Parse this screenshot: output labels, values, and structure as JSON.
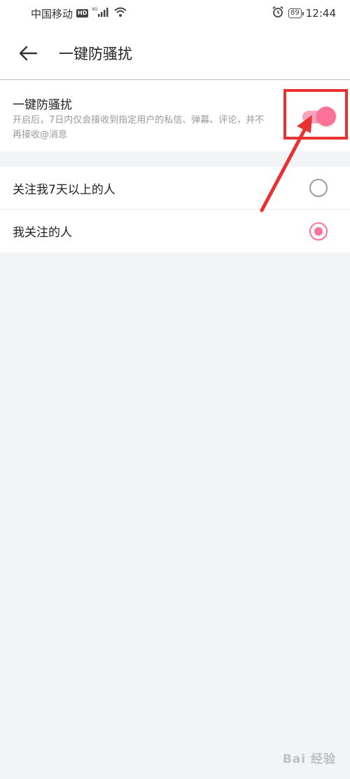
{
  "status_bar": {
    "carrier": "中国移动",
    "hd_badge": "HD",
    "network": "4G",
    "battery": "89",
    "time": "12:44",
    "icons": [
      "signal-icon",
      "wifi-icon",
      "alarm-icon",
      "battery-icon"
    ]
  },
  "header": {
    "back_icon": "back-arrow-icon",
    "title": "一键防骚扰"
  },
  "toggle": {
    "title": "一键防骚扰",
    "description": "开启后，7日内仅会接收到指定用户的私信、弹幕、评论，并不再接收@消息",
    "state": "on",
    "accent_color": "#fb7299"
  },
  "options": [
    {
      "label": "关注我7天以上的人",
      "selected": false
    },
    {
      "label": "我关注的人",
      "selected": true
    }
  ],
  "annotation": {
    "box_color": "#e83232"
  },
  "watermark": "Bai 经验"
}
